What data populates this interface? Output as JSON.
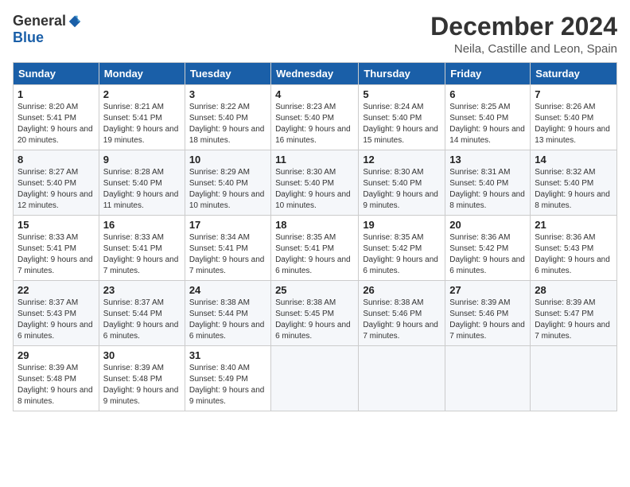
{
  "logo": {
    "general": "General",
    "blue": "Blue"
  },
  "title": "December 2024",
  "subtitle": "Neila, Castille and Leon, Spain",
  "header_days": [
    "Sunday",
    "Monday",
    "Tuesday",
    "Wednesday",
    "Thursday",
    "Friday",
    "Saturday"
  ],
  "weeks": [
    [
      {
        "day": "1",
        "sunrise": "Sunrise: 8:20 AM",
        "sunset": "Sunset: 5:41 PM",
        "daylight": "Daylight: 9 hours and 20 minutes."
      },
      {
        "day": "2",
        "sunrise": "Sunrise: 8:21 AM",
        "sunset": "Sunset: 5:41 PM",
        "daylight": "Daylight: 9 hours and 19 minutes."
      },
      {
        "day": "3",
        "sunrise": "Sunrise: 8:22 AM",
        "sunset": "Sunset: 5:40 PM",
        "daylight": "Daylight: 9 hours and 18 minutes."
      },
      {
        "day": "4",
        "sunrise": "Sunrise: 8:23 AM",
        "sunset": "Sunset: 5:40 PM",
        "daylight": "Daylight: 9 hours and 16 minutes."
      },
      {
        "day": "5",
        "sunrise": "Sunrise: 8:24 AM",
        "sunset": "Sunset: 5:40 PM",
        "daylight": "Daylight: 9 hours and 15 minutes."
      },
      {
        "day": "6",
        "sunrise": "Sunrise: 8:25 AM",
        "sunset": "Sunset: 5:40 PM",
        "daylight": "Daylight: 9 hours and 14 minutes."
      },
      {
        "day": "7",
        "sunrise": "Sunrise: 8:26 AM",
        "sunset": "Sunset: 5:40 PM",
        "daylight": "Daylight: 9 hours and 13 minutes."
      }
    ],
    [
      {
        "day": "8",
        "sunrise": "Sunrise: 8:27 AM",
        "sunset": "Sunset: 5:40 PM",
        "daylight": "Daylight: 9 hours and 12 minutes."
      },
      {
        "day": "9",
        "sunrise": "Sunrise: 8:28 AM",
        "sunset": "Sunset: 5:40 PM",
        "daylight": "Daylight: 9 hours and 11 minutes."
      },
      {
        "day": "10",
        "sunrise": "Sunrise: 8:29 AM",
        "sunset": "Sunset: 5:40 PM",
        "daylight": "Daylight: 9 hours and 10 minutes."
      },
      {
        "day": "11",
        "sunrise": "Sunrise: 8:30 AM",
        "sunset": "Sunset: 5:40 PM",
        "daylight": "Daylight: 9 hours and 10 minutes."
      },
      {
        "day": "12",
        "sunrise": "Sunrise: 8:30 AM",
        "sunset": "Sunset: 5:40 PM",
        "daylight": "Daylight: 9 hours and 9 minutes."
      },
      {
        "day": "13",
        "sunrise": "Sunrise: 8:31 AM",
        "sunset": "Sunset: 5:40 PM",
        "daylight": "Daylight: 9 hours and 8 minutes."
      },
      {
        "day": "14",
        "sunrise": "Sunrise: 8:32 AM",
        "sunset": "Sunset: 5:40 PM",
        "daylight": "Daylight: 9 hours and 8 minutes."
      }
    ],
    [
      {
        "day": "15",
        "sunrise": "Sunrise: 8:33 AM",
        "sunset": "Sunset: 5:41 PM",
        "daylight": "Daylight: 9 hours and 7 minutes."
      },
      {
        "day": "16",
        "sunrise": "Sunrise: 8:33 AM",
        "sunset": "Sunset: 5:41 PM",
        "daylight": "Daylight: 9 hours and 7 minutes."
      },
      {
        "day": "17",
        "sunrise": "Sunrise: 8:34 AM",
        "sunset": "Sunset: 5:41 PM",
        "daylight": "Daylight: 9 hours and 7 minutes."
      },
      {
        "day": "18",
        "sunrise": "Sunrise: 8:35 AM",
        "sunset": "Sunset: 5:41 PM",
        "daylight": "Daylight: 9 hours and 6 minutes."
      },
      {
        "day": "19",
        "sunrise": "Sunrise: 8:35 AM",
        "sunset": "Sunset: 5:42 PM",
        "daylight": "Daylight: 9 hours and 6 minutes."
      },
      {
        "day": "20",
        "sunrise": "Sunrise: 8:36 AM",
        "sunset": "Sunset: 5:42 PM",
        "daylight": "Daylight: 9 hours and 6 minutes."
      },
      {
        "day": "21",
        "sunrise": "Sunrise: 8:36 AM",
        "sunset": "Sunset: 5:43 PM",
        "daylight": "Daylight: 9 hours and 6 minutes."
      }
    ],
    [
      {
        "day": "22",
        "sunrise": "Sunrise: 8:37 AM",
        "sunset": "Sunset: 5:43 PM",
        "daylight": "Daylight: 9 hours and 6 minutes."
      },
      {
        "day": "23",
        "sunrise": "Sunrise: 8:37 AM",
        "sunset": "Sunset: 5:44 PM",
        "daylight": "Daylight: 9 hours and 6 minutes."
      },
      {
        "day": "24",
        "sunrise": "Sunrise: 8:38 AM",
        "sunset": "Sunset: 5:44 PM",
        "daylight": "Daylight: 9 hours and 6 minutes."
      },
      {
        "day": "25",
        "sunrise": "Sunrise: 8:38 AM",
        "sunset": "Sunset: 5:45 PM",
        "daylight": "Daylight: 9 hours and 6 minutes."
      },
      {
        "day": "26",
        "sunrise": "Sunrise: 8:38 AM",
        "sunset": "Sunset: 5:46 PM",
        "daylight": "Daylight: 9 hours and 7 minutes."
      },
      {
        "day": "27",
        "sunrise": "Sunrise: 8:39 AM",
        "sunset": "Sunset: 5:46 PM",
        "daylight": "Daylight: 9 hours and 7 minutes."
      },
      {
        "day": "28",
        "sunrise": "Sunrise: 8:39 AM",
        "sunset": "Sunset: 5:47 PM",
        "daylight": "Daylight: 9 hours and 7 minutes."
      }
    ],
    [
      {
        "day": "29",
        "sunrise": "Sunrise: 8:39 AM",
        "sunset": "Sunset: 5:48 PM",
        "daylight": "Daylight: 9 hours and 8 minutes."
      },
      {
        "day": "30",
        "sunrise": "Sunrise: 8:39 AM",
        "sunset": "Sunset: 5:48 PM",
        "daylight": "Daylight: 9 hours and 9 minutes."
      },
      {
        "day": "31",
        "sunrise": "Sunrise: 8:40 AM",
        "sunset": "Sunset: 5:49 PM",
        "daylight": "Daylight: 9 hours and 9 minutes."
      },
      null,
      null,
      null,
      null
    ]
  ]
}
